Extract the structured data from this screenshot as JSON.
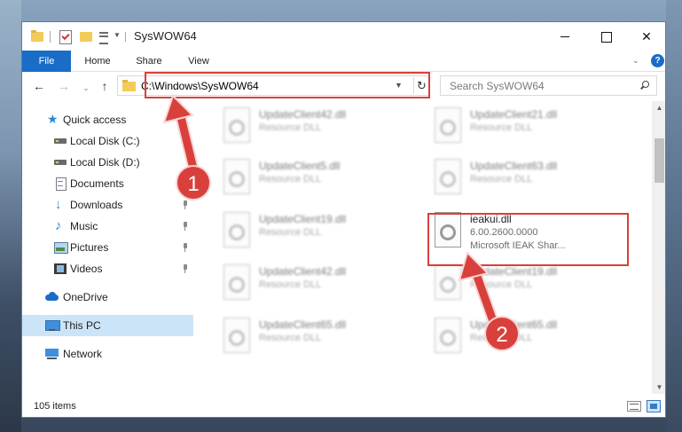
{
  "window": {
    "title": "SysWOW64",
    "minimize_label": "",
    "maximize_label": "",
    "close_label": "✕"
  },
  "ribbon": {
    "tabs": [
      "File",
      "Home",
      "Share",
      "View"
    ],
    "help_label": "?"
  },
  "address": {
    "path": "C:\\Windows\\SysWOW64",
    "search_placeholder": "Search SysWOW64"
  },
  "sidebar": {
    "items": [
      {
        "label": "Quick access",
        "icon": "star-icon"
      },
      {
        "label": "Local Disk (C:)",
        "icon": "disk-icon"
      },
      {
        "label": "Local Disk (D:)",
        "icon": "disk-icon"
      },
      {
        "label": "Documents",
        "icon": "documents-icon"
      },
      {
        "label": "Downloads",
        "icon": "downloads-icon",
        "pinned": true
      },
      {
        "label": "Music",
        "icon": "music-icon",
        "pinned": true
      },
      {
        "label": "Pictures",
        "icon": "pictures-icon",
        "pinned": true
      },
      {
        "label": "Videos",
        "icon": "videos-icon",
        "pinned": true
      },
      {
        "label": "OneDrive",
        "icon": "onedrive-icon"
      },
      {
        "label": "This PC",
        "icon": "this-pc-icon",
        "selected": true
      },
      {
        "label": "Network",
        "icon": "network-icon"
      }
    ]
  },
  "files": [
    {
      "name": "UpdateClient42.dll",
      "desc": "Resource DLL"
    },
    {
      "name": "UpdateClient21.dll",
      "desc": "Resource DLL"
    },
    {
      "name": "UpdateClient5.dll",
      "desc": "Resource DLL"
    },
    {
      "name": "UpdateClient63.dll",
      "desc": "Resource DLL"
    },
    {
      "name": "UpdateClient19.dll",
      "desc": "Resource DLL"
    },
    {
      "name": "ieakui.dll",
      "desc": "6.00.2600.0000",
      "desc2": "Microsoft IEAK Shar..."
    },
    {
      "name": "UpdateClient42.dll",
      "desc": "Resource DLL"
    },
    {
      "name": "UpdateClient19.dll",
      "desc": "Resource DLL"
    },
    {
      "name": "UpdateClient65.dll",
      "desc": "Resource DLL"
    },
    {
      "name": "UpdateClient65.dll",
      "desc": "Resource DLL"
    }
  ],
  "status": {
    "item_count": "105 items"
  },
  "callouts": {
    "step1": "1",
    "step2": "2",
    "accent": "#d9403c"
  }
}
